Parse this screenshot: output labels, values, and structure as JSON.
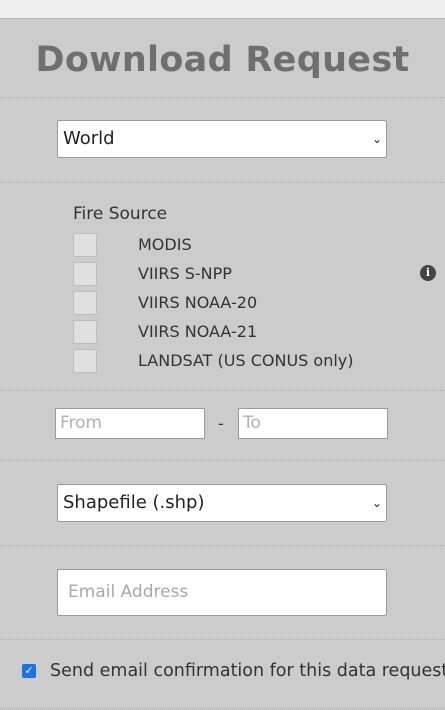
{
  "title": "Download Request",
  "region_select": {
    "value": "World"
  },
  "fire_source": {
    "label": "Fire Source",
    "options": [
      {
        "label": "MODIS",
        "checked": false
      },
      {
        "label": "VIIRS S-NPP",
        "checked": false
      },
      {
        "label": "VIIRS NOAA-20",
        "checked": false
      },
      {
        "label": "VIIRS NOAA-21",
        "checked": false
      },
      {
        "label": "LANDSAT (US CONUS only)",
        "checked": false
      }
    ]
  },
  "date_range": {
    "from_placeholder": "From",
    "separator": "-",
    "to_placeholder": "To"
  },
  "format_select": {
    "value": "Shapefile (.shp)"
  },
  "email": {
    "placeholder": "Email Address"
  },
  "confirmation": {
    "label": "Send email confirmation for this data request",
    "checked": true
  },
  "icons": {
    "info": "info-circle-icon",
    "dropdown": "chevron-down-icon"
  }
}
